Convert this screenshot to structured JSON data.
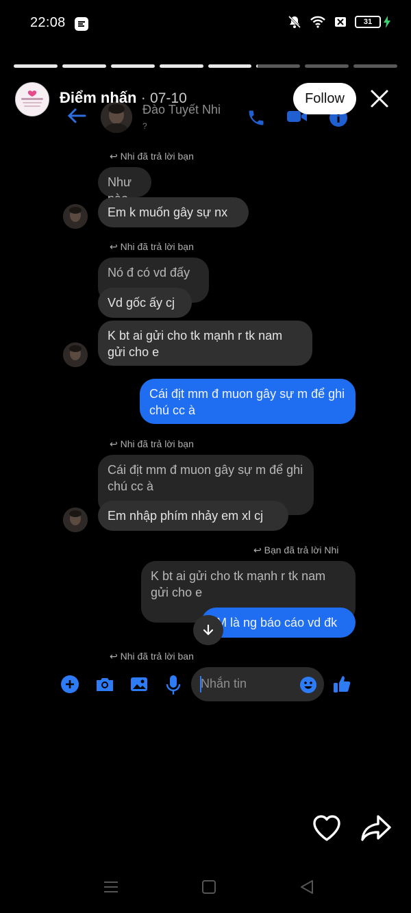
{
  "status": {
    "time": "22:08",
    "battery": "31"
  },
  "story": {
    "title": "Điểm nhấn",
    "separator": "·",
    "date": "07-10",
    "follow_label": "Follow",
    "progress": [
      1,
      1,
      1,
      1,
      1,
      0.03,
      0,
      0
    ]
  },
  "messenger": {
    "contact_name": "Đào Tuyết Nhi",
    "contact_sub": "?"
  },
  "chat": {
    "reply_nhi": "Nhi đã trả lời bạn",
    "reply_ban": "Bạn đã trả lời Nhi",
    "m1_quote": "Như nào",
    "m1_text": "Em k muốn gây sự nx",
    "m2_quote": "Nó đ có vd đấy",
    "m2_text": "Vd gốc ấy cj",
    "m3_text": "K bt ai gửi cho tk mạnh r tk nam gửi cho e",
    "m4_out": "Cái địt mm đ muon gây sự m để ghi chú cc à",
    "m5_quote": "Cái địt mm đ muon gây sự m để ghi chú cc à",
    "m5_text": "Em nhập phím nhảy em xl cj",
    "m6_quote": "K bt ai gửi cho tk mạnh r tk nam gửi cho e",
    "m6_out": "M là ng báo cáo vd đk",
    "reply_nhi_last": "Nhi đã trả lời bạn"
  },
  "composer": {
    "placeholder": "Nhắn tin"
  },
  "colors": {
    "accent": "#1f6df0",
    "icon_blue": "#2d7cf6"
  }
}
